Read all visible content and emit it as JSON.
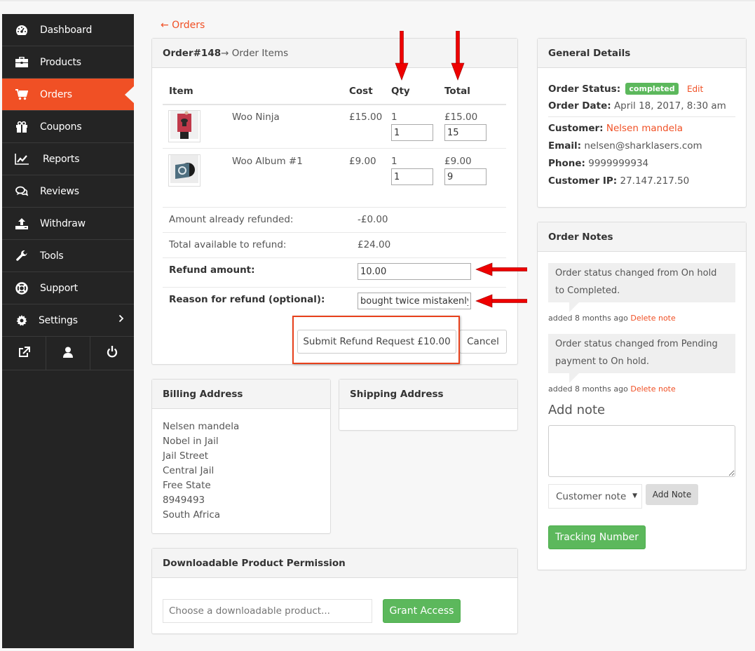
{
  "sidebar": {
    "items": [
      {
        "label": "Dashboard",
        "icon": "dashboard-icon"
      },
      {
        "label": "Products",
        "icon": "briefcase-icon"
      },
      {
        "label": "Orders",
        "icon": "cart-icon",
        "active": true
      },
      {
        "label": "Coupons",
        "icon": "gift-icon"
      },
      {
        "label": "Reports",
        "icon": "chart-line-icon"
      },
      {
        "label": "Reviews",
        "icon": "comments-icon"
      },
      {
        "label": "Withdraw",
        "icon": "upload-icon"
      },
      {
        "label": "Tools",
        "icon": "wrench-icon"
      },
      {
        "label": "Support",
        "icon": "lifebuoy-icon"
      },
      {
        "label": "Settings",
        "icon": "gear-icon",
        "has_submenu": true
      }
    ],
    "bottom_icons": [
      "external-link-icon",
      "user-icon",
      "power-icon"
    ]
  },
  "back_link": "← Orders",
  "order_items": {
    "header_bold": "Order#148",
    "header_rest": " → Order Items",
    "columns": [
      "Item",
      "Cost",
      "Qty",
      "Total"
    ],
    "rows": [
      {
        "name": "Woo Ninja",
        "cost": "£15.00",
        "qty": "1",
        "qty_input": "1",
        "total": "£15.00",
        "total_input": "15"
      },
      {
        "name": "Woo Album #1",
        "cost": "£9.00",
        "qty": "1",
        "qty_input": "1",
        "total": "£9.00",
        "total_input": "9"
      }
    ],
    "refund": {
      "already_refunded_label": "Amount already refunded:",
      "already_refunded_value": "-£0.00",
      "available_label": "Total available to refund:",
      "available_value": "£24.00",
      "amount_label": "Refund amount:",
      "amount_value": "10.00",
      "reason_label": "Reason for refund (optional):",
      "reason_value": "bought twice mistakenly",
      "submit_label": "Submit Refund Request £10.00",
      "cancel_label": "Cancel"
    }
  },
  "billing": {
    "title": "Billing Address",
    "lines": [
      "Nelsen mandela",
      "Nobel in Jail",
      "Jail Street",
      "Central Jail",
      "Free State",
      "8949493",
      "South Africa"
    ]
  },
  "shipping": {
    "title": "Shipping Address"
  },
  "downloadable": {
    "title": "Downloadable Product Permission",
    "placeholder": "Choose a downloadable product...",
    "grant_label": "Grant Access"
  },
  "general": {
    "title": "General Details",
    "status_label": "Order Status:",
    "status_value": "completed",
    "edit_label": "Edit",
    "date_label": "Order Date:",
    "date_value": "April 18, 2017, 8:30 am",
    "customer_label": "Customer:",
    "customer_value": "Nelsen mandela",
    "email_label": "Email:",
    "email_value": "nelsen@sharklasers.com",
    "phone_label": "Phone:",
    "phone_value": "9999999934",
    "ip_label": "Customer IP:",
    "ip_value": "27.147.217.50"
  },
  "notes": {
    "title": "Order Notes",
    "items": [
      {
        "text": "Order status changed from On hold to Completed.",
        "meta": "added 8 months ago",
        "delete": "Delete note"
      },
      {
        "text": "Order status changed from Pending payment to On hold.",
        "meta": "added 8 months ago",
        "delete": "Delete note"
      }
    ],
    "add_note_title": "Add note",
    "note_type_selected": "Customer note",
    "add_note_button": "Add Note",
    "tracking_button": "Tracking Number"
  },
  "colors": {
    "accent": "#f05025",
    "sidebar_bg": "#242424",
    "success": "#5cb85c"
  }
}
